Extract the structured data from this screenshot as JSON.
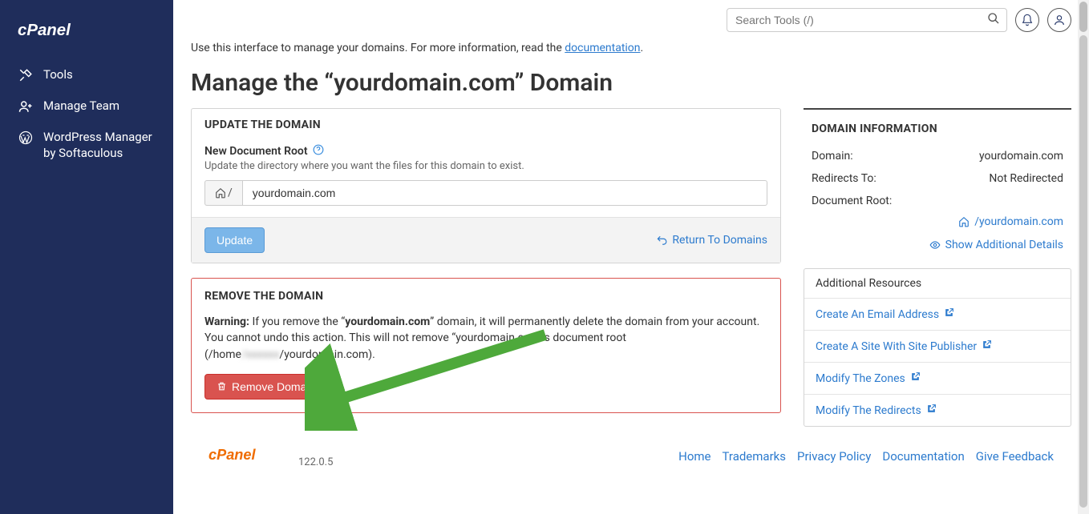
{
  "sidebar": {
    "items": [
      {
        "label": "Tools"
      },
      {
        "label": "Manage Team"
      },
      {
        "label": "WordPress Manager by Softaculous"
      }
    ]
  },
  "topbar": {
    "search_placeholder": "Search Tools (/)"
  },
  "intro": {
    "prefix": "Use this interface to manage your domains. For more information, read the ",
    "link": "documentation",
    "suffix": "."
  },
  "page_title": "Manage the “yourdomain.com” Domain",
  "update_panel": {
    "heading": "UPDATE THE DOMAIN",
    "field_label": "New Document Root",
    "hint": "Update the directory where you want the files for this domain to exist.",
    "prefix_symbol": "/",
    "value": "yourdomain.com",
    "update_btn": "Update",
    "return_link": "Return To Domains"
  },
  "remove_panel": {
    "heading": "REMOVE THE DOMAIN",
    "warn_label": "Warning:",
    "warn_text_1": " If you remove the “",
    "domain_bold": "yourdomain.com",
    "warn_text_2": "” domain, it will permanently delete the domain from your account. You cannot undo this action. This will not remove “yourdomain.com”'s document root (/home",
    "blurred": "/xxxxxx",
    "warn_text_3": "/yourdomain.com).",
    "remove_btn": "Remove Domain"
  },
  "domain_info": {
    "heading": "DOMAIN INFORMATION",
    "rows": {
      "domain_label": "Domain:",
      "domain_value": "yourdomain.com",
      "redirects_label": "Redirects To:",
      "redirects_value": "Not Redirected",
      "docroot_label": "Document Root:",
      "docroot_value": "/yourdomain.com"
    },
    "additional": "Show Additional Details"
  },
  "resources": {
    "heading": "Additional Resources",
    "items": [
      "Create An Email Address",
      "Create A Site With Site Publisher",
      "Modify The Zones",
      "Modify The Redirects"
    ]
  },
  "footer": {
    "version": "122.0.5",
    "links": [
      "Home",
      "Trademarks",
      "Privacy Policy",
      "Documentation",
      "Give Feedback"
    ]
  }
}
